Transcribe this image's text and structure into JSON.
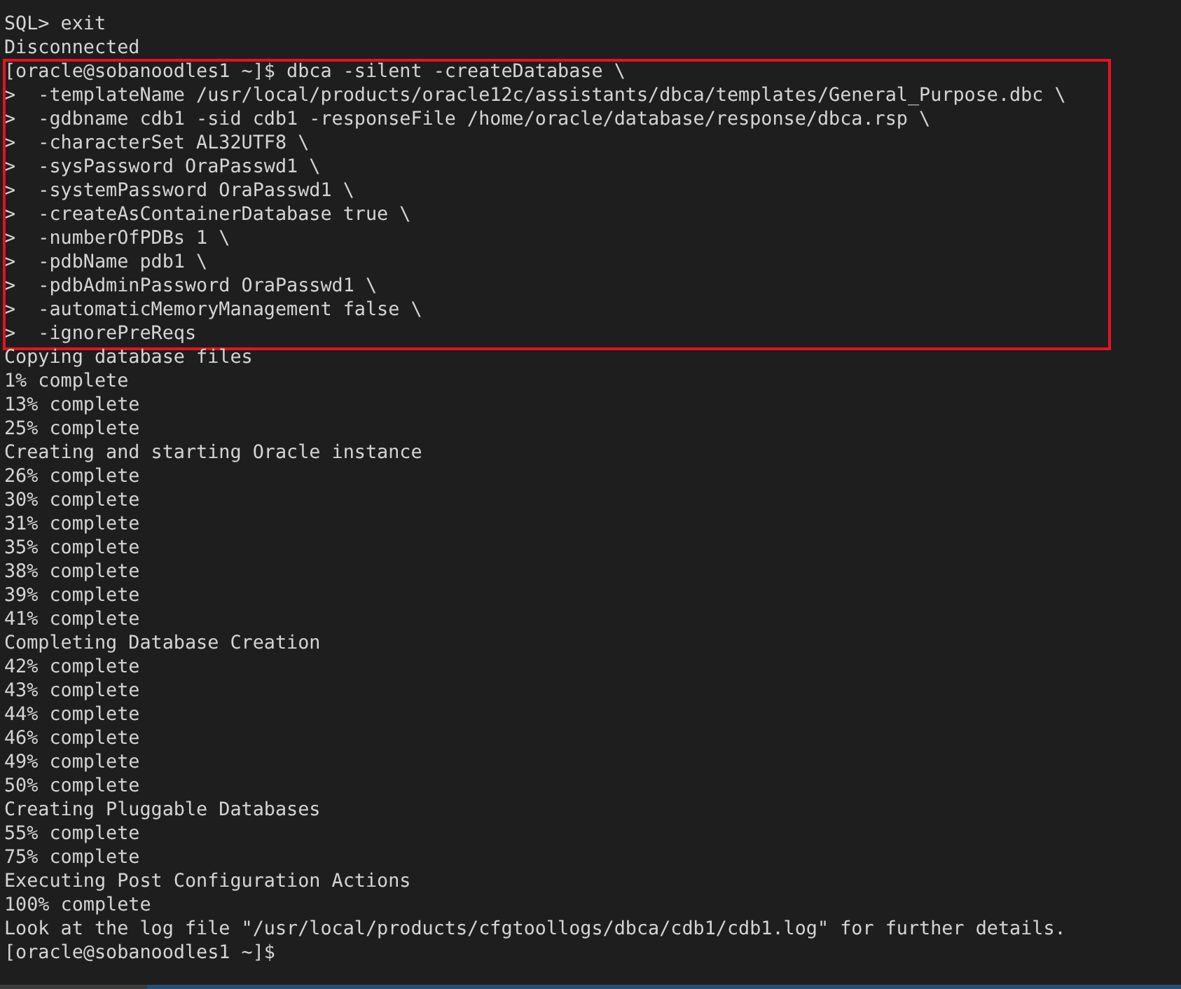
{
  "blocks": [
    {
      "highlighted": false,
      "lines": [
        "SQL> exit",
        "Disconnected"
      ]
    },
    {
      "highlighted": true,
      "lines": [
        "[oracle@sobanoodles1 ~]$ dbca -silent -createDatabase \\",
        ">  -templateName /usr/local/products/oracle12c/assistants/dbca/templates/General_Purpose.dbc \\",
        ">  -gdbname cdb1 -sid cdb1 -responseFile /home/oracle/database/response/dbca.rsp \\",
        ">  -characterSet AL32UTF8 \\",
        ">  -sysPassword OraPasswd1 \\",
        ">  -systemPassword OraPasswd1 \\",
        ">  -createAsContainerDatabase true \\",
        ">  -numberOfPDBs 1 \\",
        ">  -pdbName pdb1 \\",
        ">  -pdbAdminPassword OraPasswd1 \\",
        ">  -automaticMemoryManagement false \\",
        ">  -ignorePreReqs"
      ]
    },
    {
      "highlighted": false,
      "lines": [
        "Copying database files",
        "1% complete",
        "13% complete",
        "25% complete",
        "Creating and starting Oracle instance",
        "26% complete",
        "30% complete",
        "31% complete",
        "35% complete",
        "38% complete",
        "39% complete",
        "41% complete",
        "Completing Database Creation",
        "42% complete",
        "43% complete",
        "44% complete",
        "46% complete",
        "49% complete",
        "50% complete",
        "Creating Pluggable Databases",
        "55% complete",
        "75% complete",
        "Executing Post Configuration Actions",
        "100% complete",
        "Look at the log file \"/usr/local/products/cfgtoollogs/dbca/cdb1/cdb1.log\" for further details.",
        "[oracle@sobanoodles1 ~]$"
      ]
    }
  ]
}
